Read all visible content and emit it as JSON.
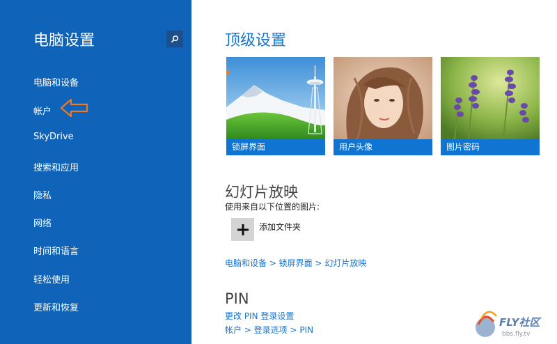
{
  "sidebar": {
    "title": "电脑设置",
    "items": [
      {
        "label": "电脑和设备"
      },
      {
        "label": "帐户"
      },
      {
        "label": "SkyDrive"
      },
      {
        "label": "搜索和应用"
      },
      {
        "label": "隐私"
      },
      {
        "label": "网络"
      },
      {
        "label": "时间和语言"
      },
      {
        "label": "轻松使用"
      },
      {
        "label": "更新和恢复"
      }
    ]
  },
  "main": {
    "top_title": "顶级设置",
    "tiles": [
      {
        "caption": "锁屏界面"
      },
      {
        "caption": "用户头像"
      },
      {
        "caption": "图片密码"
      }
    ],
    "slideshow": {
      "title": "幻灯片放映",
      "subtitle": "使用来自以下位置的图片:",
      "add_folder_label": "添加文件夹",
      "path_link": "电脑和设备 > 锁屏界面 > 幻灯片放映"
    },
    "pin": {
      "title": "PIN",
      "change_link": "更改 PIN 登录设置",
      "path_link": "帐户 > 登录选项 > PIN"
    }
  },
  "watermark": {
    "brand": "FLY社区",
    "site": "bbs.fly.tv"
  },
  "colors": {
    "sidebar_bg": "#0f63b8",
    "accent": "#1774d0",
    "tile_caption_bg": "#0f74d2",
    "arrow": "#f07a22"
  }
}
